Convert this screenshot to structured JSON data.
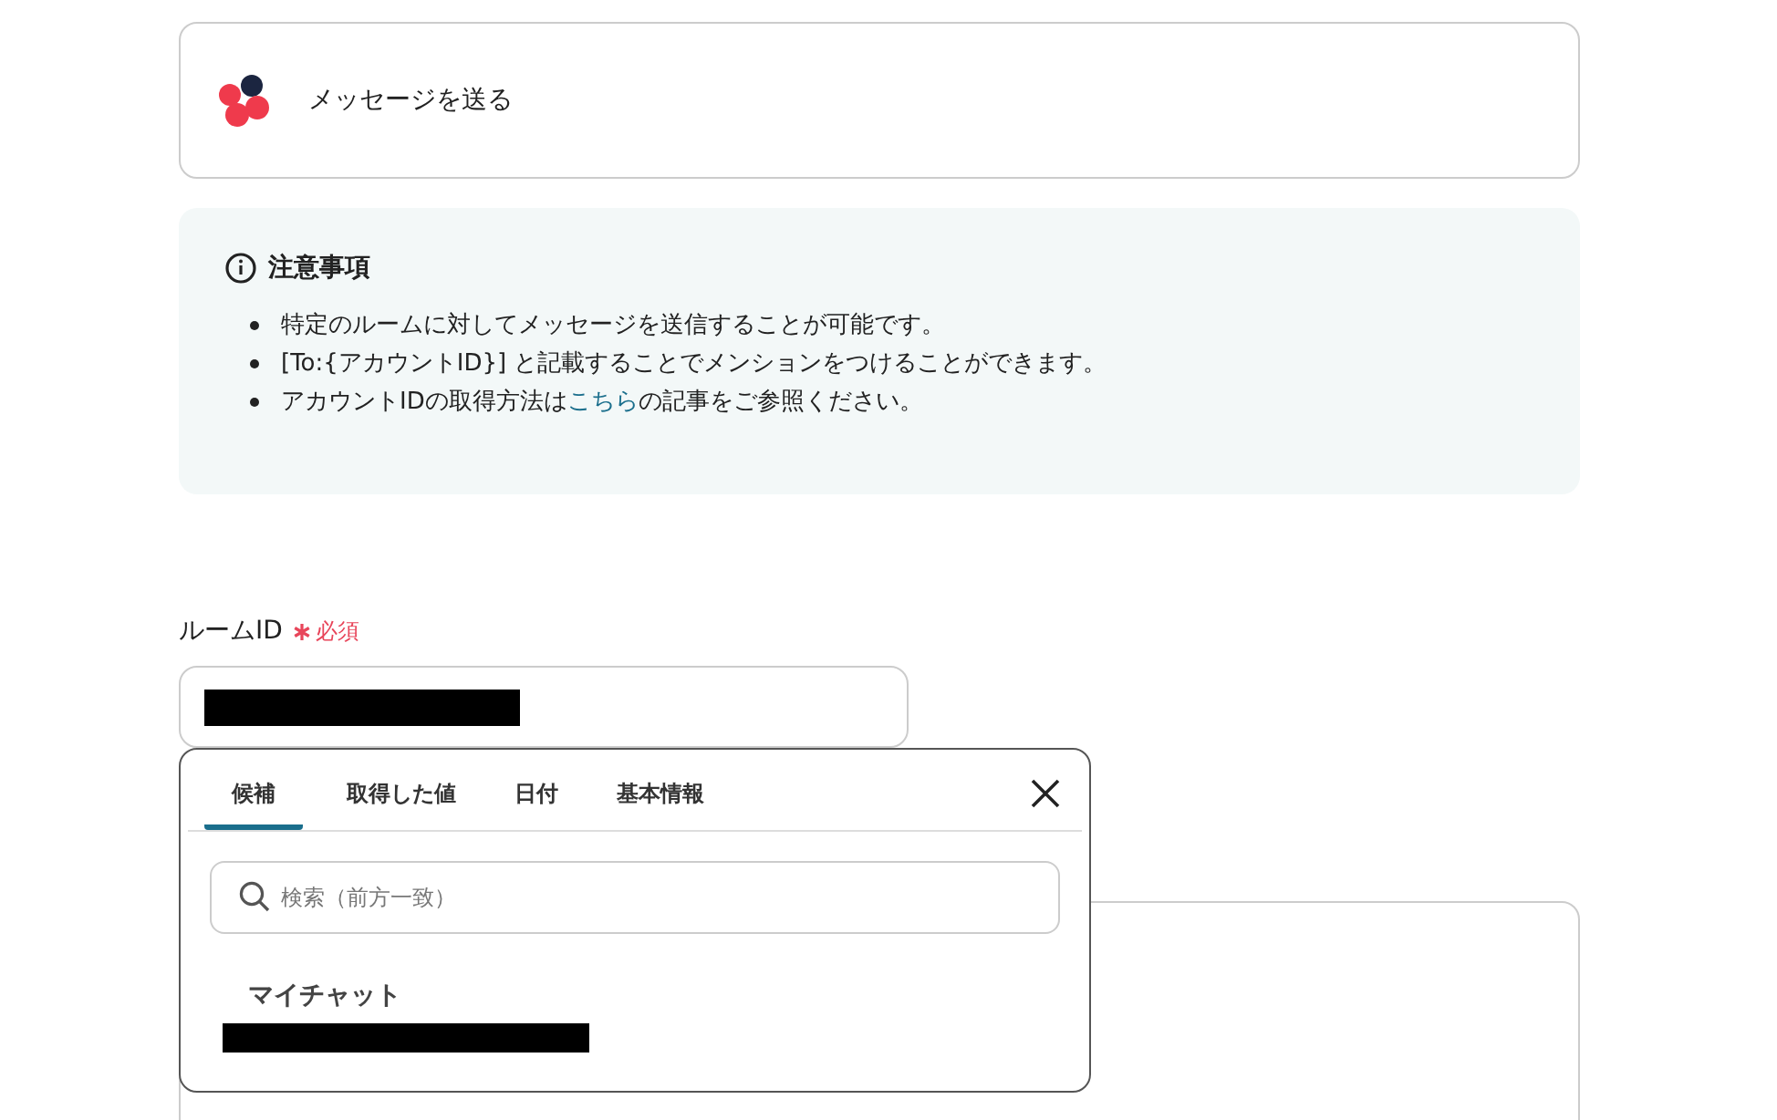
{
  "action_card": {
    "title": "メッセージを送る"
  },
  "notice": {
    "title": "注意事項",
    "items": [
      {
        "kind": "text",
        "text": "特定のルームに対してメッセージを送信することが可能です。"
      },
      {
        "kind": "text",
        "text": "[To:{アカウントID}] と記載することでメンションをつけることができます。"
      },
      {
        "kind": "link",
        "before": "アカウントIDの取得方法は",
        "link": "こちら",
        "after": "の記事をご参照ください。"
      }
    ]
  },
  "field": {
    "label": "ルームID",
    "required": true,
    "required_label": "必須",
    "value_redacted": true
  },
  "dropdown": {
    "tabs": [
      {
        "label": "候補",
        "selected": true
      },
      {
        "label": "取得した値",
        "selected": false
      },
      {
        "label": "日付",
        "selected": false
      },
      {
        "label": "基本情報",
        "selected": false
      }
    ],
    "search": {
      "placeholder": "検索（前方一致）"
    },
    "options": [
      {
        "label": "マイチャット",
        "redacted": true
      }
    ]
  }
}
